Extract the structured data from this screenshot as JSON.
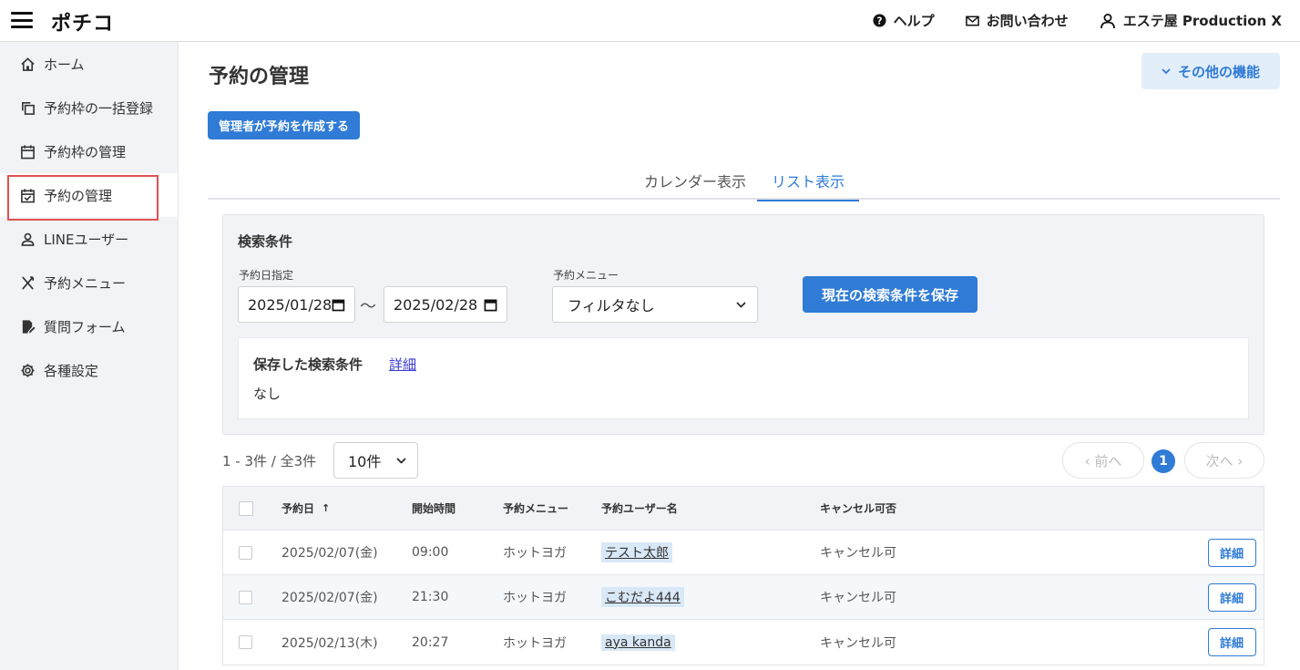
{
  "header": {
    "logo": "ポチコ",
    "help": "ヘルプ",
    "contact": "お問い合わせ",
    "account": "エステ屋 Production X"
  },
  "sidebar": {
    "items": [
      {
        "label": "ホーム",
        "icon": "home-icon"
      },
      {
        "label": "予約枠の一括登録",
        "icon": "copy-icon"
      },
      {
        "label": "予約枠の管理",
        "icon": "calendar-icon"
      },
      {
        "label": "予約の管理",
        "icon": "calendar-check-icon",
        "active": true
      },
      {
        "label": "LINEユーザー",
        "icon": "user-icon"
      },
      {
        "label": "予約メニュー",
        "icon": "utensils-icon"
      },
      {
        "label": "質問フォーム",
        "icon": "form-edit-icon"
      },
      {
        "label": "各種設定",
        "icon": "gear-icon"
      }
    ]
  },
  "main": {
    "title": "予約の管理",
    "other_features": "その他の機能",
    "create_button": "管理者が予約を作成する",
    "tabs": [
      {
        "label": "カレンダー表示",
        "active": false
      },
      {
        "label": "リスト表示",
        "active": true
      }
    ]
  },
  "search": {
    "title": "検索条件",
    "date_label": "予約日指定",
    "date_from": "2025/01/28",
    "date_to": "2025/02/28",
    "tilde": "〜",
    "menu_label": "予約メニュー",
    "menu_value": "フィルタなし",
    "save_button": "現在の検索条件を保存",
    "saved_title": "保存した検索条件",
    "saved_detail_link": "詳細",
    "saved_value": "なし"
  },
  "pagination": {
    "count_text": "1 - 3件 / 全3件",
    "per_page": "10件",
    "prev": "‹ 前へ",
    "next": "次へ ›",
    "current_page": "1"
  },
  "table": {
    "headers": {
      "date": "予約日",
      "sort": "↑",
      "start_time": "開始時間",
      "menu": "予約メニュー",
      "user": "予約ユーザー名",
      "cancel": "キャンセル可否"
    },
    "detail_label": "詳細",
    "rows": [
      {
        "date": "2025/02/07(金)",
        "time": "09:00",
        "menu": "ホットヨガ",
        "user": "テスト太郎",
        "cancel": "キャンセル可"
      },
      {
        "date": "2025/02/07(金)",
        "time": "21:30",
        "menu": "ホットヨガ",
        "user": "こむだよ444",
        "cancel": "キャンセル可"
      },
      {
        "date": "2025/02/13(木)",
        "time": "20:27",
        "menu": "ホットヨガ",
        "user": "aya kanda",
        "cancel": "キャンセル可"
      }
    ]
  },
  "colors": {
    "accent": "#2f7bd6",
    "sidebar_bg": "#f2f3f7",
    "highlight_outline": "#e05252"
  }
}
